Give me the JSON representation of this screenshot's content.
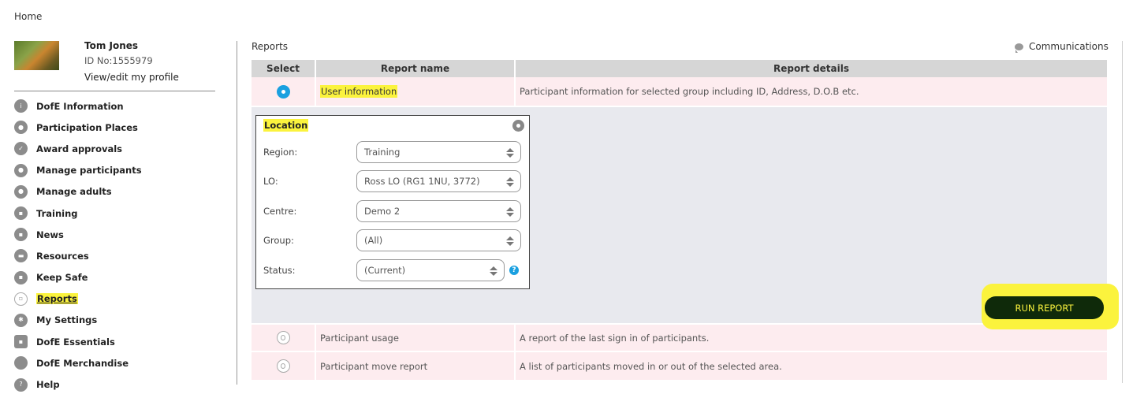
{
  "breadcrumb": "Home",
  "profile": {
    "name": "Tom Jones",
    "id_text": "ID No:1555979",
    "edit_link": "View/edit my profile"
  },
  "sidebar": {
    "items": [
      {
        "label": "DofE Information",
        "icon": "info-icon"
      },
      {
        "label": "Participation Places",
        "icon": "user-icon"
      },
      {
        "label": "Award approvals",
        "icon": "check-badge-icon"
      },
      {
        "label": "Manage participants",
        "icon": "users-icon"
      },
      {
        "label": "Manage adults",
        "icon": "adult-icon"
      },
      {
        "label": "Training",
        "icon": "training-icon"
      },
      {
        "label": "News",
        "icon": "news-icon"
      },
      {
        "label": "Resources",
        "icon": "folder-icon"
      },
      {
        "label": "Keep Safe",
        "icon": "lock-icon"
      },
      {
        "label": "Reports",
        "icon": "document-icon"
      },
      {
        "label": "My Settings",
        "icon": "gear-icon"
      },
      {
        "label": "DofE Essentials",
        "icon": "cart-icon"
      },
      {
        "label": "DofE Merchandise",
        "icon": "shop-icon"
      },
      {
        "label": "Help",
        "icon": "help-icon"
      }
    ]
  },
  "main": {
    "title": "Reports",
    "communications": "Communications",
    "table": {
      "headers": [
        "Select",
        "Report name",
        "Report details"
      ],
      "rows": [
        {
          "name": "User information",
          "details": "Participant information for selected group including ID, Address, D.O.B etc.",
          "selected": true
        },
        {
          "name": "Participant usage",
          "details": "A report of the last sign in of participants.",
          "selected": false
        },
        {
          "name": "Participant move report",
          "details": "A list of participants moved in or out of the selected area.",
          "selected": false
        }
      ]
    },
    "location": {
      "title": "Location",
      "fields": [
        {
          "label": "Region:",
          "value": "Training"
        },
        {
          "label": "LO:",
          "value": "Ross LO (RG1 1NU, 3772)"
        },
        {
          "label": "Centre:",
          "value": "Demo 2"
        },
        {
          "label": "Group:",
          "value": "(All)"
        },
        {
          "label": "Status:",
          "value": "(Current)"
        }
      ]
    },
    "run_button": "RUN REPORT"
  },
  "colors": {
    "highlight": "#fbf33d",
    "accent_blue": "#1aa0e0",
    "row_pink": "#fdecef",
    "button_dark": "#0f2a0a"
  }
}
